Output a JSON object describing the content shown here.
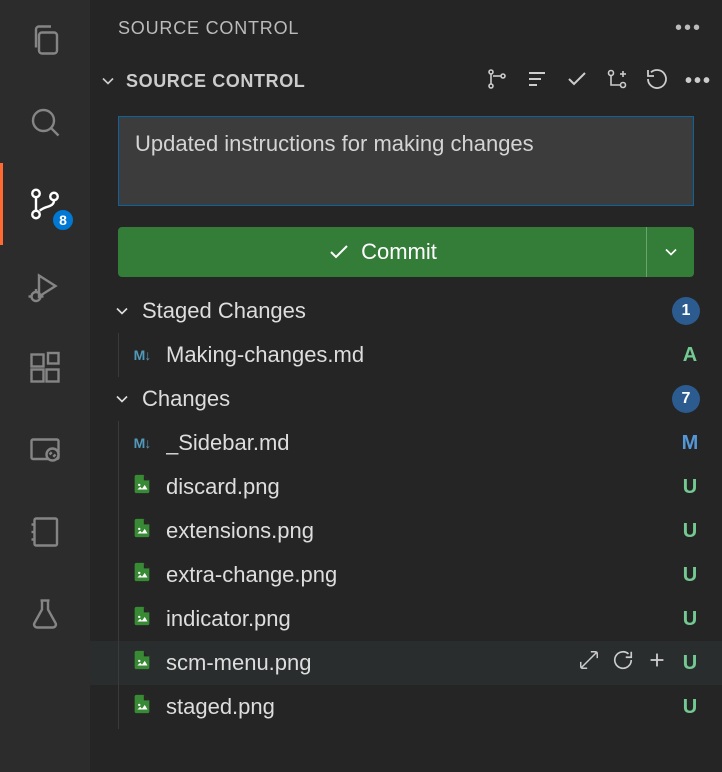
{
  "panel": {
    "title": "SOURCE CONTROL"
  },
  "section": {
    "title": "SOURCE CONTROL",
    "commit_message": "Updated instructions for making changes",
    "commit_button": "Commit"
  },
  "activity": {
    "scm_badge": "8"
  },
  "groups": {
    "staged": {
      "label": "Staged Changes",
      "count": "1"
    },
    "changes": {
      "label": "Changes",
      "count": "7"
    }
  },
  "staged_files": [
    {
      "name": "Making-changes.md",
      "status": "A",
      "type": "md"
    }
  ],
  "changes_files": [
    {
      "name": "_Sidebar.md",
      "status": "M",
      "type": "md"
    },
    {
      "name": "discard.png",
      "status": "U",
      "type": "img"
    },
    {
      "name": "extensions.png",
      "status": "U",
      "type": "img"
    },
    {
      "name": "extra-change.png",
      "status": "U",
      "type": "img"
    },
    {
      "name": "indicator.png",
      "status": "U",
      "type": "img"
    },
    {
      "name": "scm-menu.png",
      "status": "U",
      "type": "img",
      "hovered": true
    },
    {
      "name": "staged.png",
      "status": "U",
      "type": "img"
    }
  ]
}
